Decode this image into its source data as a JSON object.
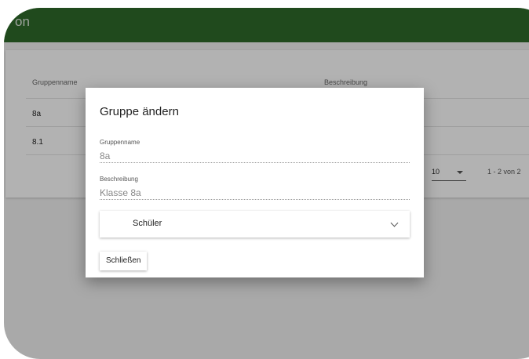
{
  "appbar": {
    "title": "on"
  },
  "table": {
    "columns": [
      "Gruppenname",
      "Beschreibung"
    ],
    "rows": [
      {
        "name": "8a"
      },
      {
        "name": "8.1"
      }
    ],
    "pager": {
      "per_page": "10",
      "range": "1 - 2 von 2"
    }
  },
  "dialog": {
    "title": "Gruppe ändern",
    "fields": {
      "name": {
        "label": "Gruppenname",
        "value": "8a"
      },
      "description": {
        "label": "Beschreibung",
        "value": "Klasse 8a"
      }
    },
    "expander": {
      "label": "Schüler"
    },
    "close_label": "Schließen"
  },
  "colors": {
    "appbar": "#2e6b2a",
    "overlay": "rgba(0,0,0,0.30)"
  },
  "icons": {
    "expander": "chevron-down-icon",
    "pager": "dropdown-arrow-icon"
  }
}
